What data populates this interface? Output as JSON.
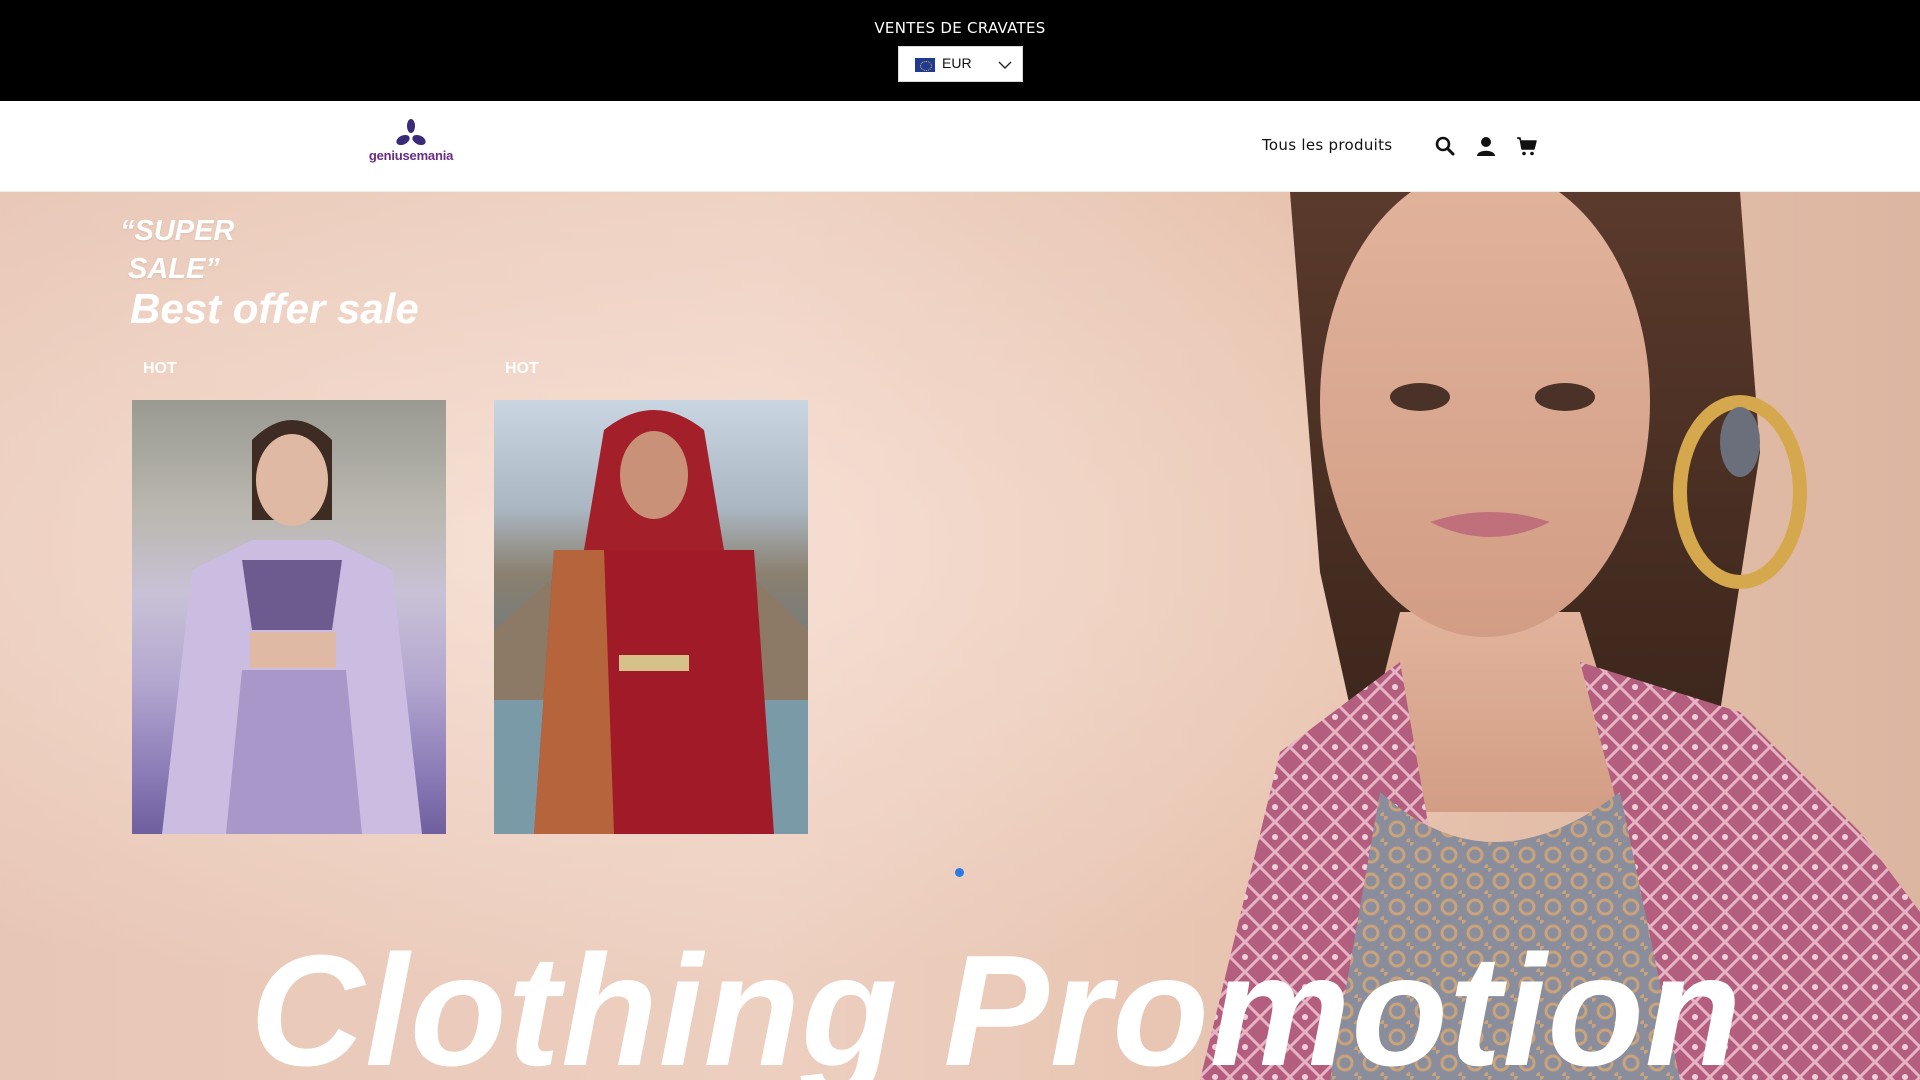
{
  "announcement": {
    "text": "VENTES DE CRAVATES"
  },
  "currency": {
    "code": "EUR",
    "flag": "eu-flag-icon"
  },
  "header": {
    "logo_text": "geniusemania",
    "nav": {
      "all_products": "Tous les produits"
    },
    "icons": [
      "search-icon",
      "account-icon",
      "cart-icon"
    ]
  },
  "hero": {
    "super_line1": "“SUPER",
    "super_line2": "SALE”",
    "best_offer": "Best offer sale",
    "products": [
      {
        "badge": "HOT"
      },
      {
        "badge": "HOT"
      }
    ],
    "promo_text": "Clothing Promotion",
    "slides_count": 1,
    "active_slide": 1
  },
  "colors": {
    "announcement_bg": "#000000",
    "logo": "#6b2a86",
    "hero_bg": "#e8c6b5",
    "slider_dot": "#2c7be5"
  }
}
